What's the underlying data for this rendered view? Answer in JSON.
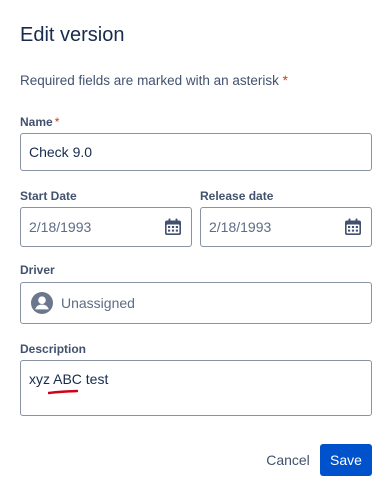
{
  "dialog": {
    "title": "Edit version",
    "required_note": "Required fields are marked with an asterisk",
    "asterisk": "*"
  },
  "fields": {
    "name": {
      "label": "Name",
      "value": "Check 9.0"
    },
    "start_date": {
      "label": "Start Date",
      "value": "2/18/1993",
      "icon": "calendar-icon"
    },
    "release_date": {
      "label": "Release date",
      "value": "2/18/1993",
      "icon": "calendar-icon"
    },
    "driver": {
      "label": "Driver",
      "value": "Unassigned",
      "icon": "user-avatar-icon"
    },
    "description": {
      "label": "Description",
      "value": "xyz ABC test"
    }
  },
  "actions": {
    "cancel_label": "Cancel",
    "save_label": "Save"
  },
  "colors": {
    "primary": "#0052cc",
    "required": "#de350b",
    "annotation": "#d0021b"
  }
}
